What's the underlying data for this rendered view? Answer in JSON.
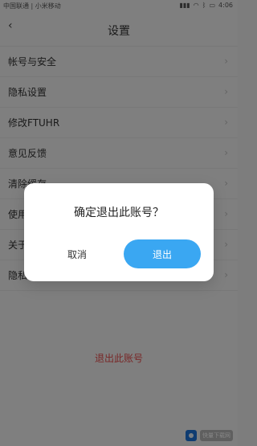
{
  "status_bar": {
    "left_text": "中国联通 | 小米移动",
    "time": "4:06",
    "icons": [
      "signal-icon",
      "wifi-icon",
      "bluetooth-icon",
      "battery-icon"
    ]
  },
  "header": {
    "title": "设置",
    "back_icon": "back-arrow-icon"
  },
  "settings": {
    "items": [
      {
        "label": "帐号与安全"
      },
      {
        "label": "隐私设置"
      },
      {
        "label": "修改FTUHR"
      },
      {
        "label": "意见反馈"
      },
      {
        "label": "清除缓存"
      },
      {
        "label": "使用帮助"
      },
      {
        "label": "关于气候通"
      },
      {
        "label": "隐私协议"
      }
    ],
    "logout_label": "退出此账号"
  },
  "dialog": {
    "message": "确定退出此账号？",
    "cancel_label": "取消",
    "confirm_label": "退出"
  },
  "watermark": {
    "text": "快量下载网"
  },
  "colors": {
    "accent": "#3aa7f2",
    "danger": "#e64b4b",
    "overlay": "#000000"
  }
}
